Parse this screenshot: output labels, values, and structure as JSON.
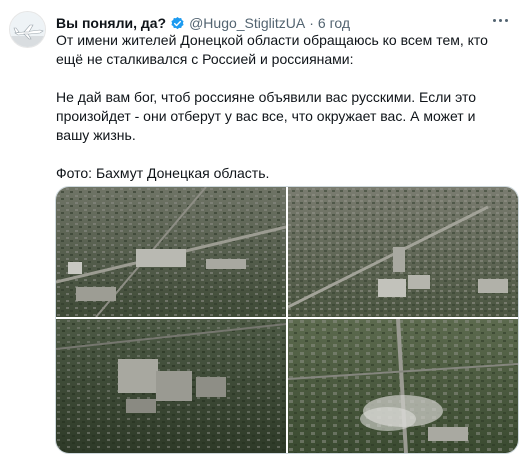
{
  "tweet": {
    "author_name": "Вы поняли, да?",
    "handle": "@Hugo_StiglitzUA",
    "separator": "·",
    "time": "6 год",
    "paragraphs": [
      "От имени жителей Донецкой области обращаюсь ко всем тем, кто ещё не сталкивался с Россией и россиянами:",
      "Не дай вам бог, чтоб россияне объявили вас русскими. Если это произойдет - они отберут у вас все, что окружает вас. А может и вашу жизнь.",
      "Фото: Бахмут Донецкая область."
    ]
  },
  "icons": {
    "avatar": "airplane-avatar-icon",
    "verified": "verified-badge-icon",
    "more": "more-options-icon"
  },
  "colors": {
    "text": "#0f1419",
    "secondary": "#536471",
    "verified": "#1d9bf0",
    "border": "#cfd9de"
  },
  "photos": [
    {
      "name": "photo-1"
    },
    {
      "name": "photo-2"
    },
    {
      "name": "photo-3"
    },
    {
      "name": "photo-4"
    }
  ]
}
